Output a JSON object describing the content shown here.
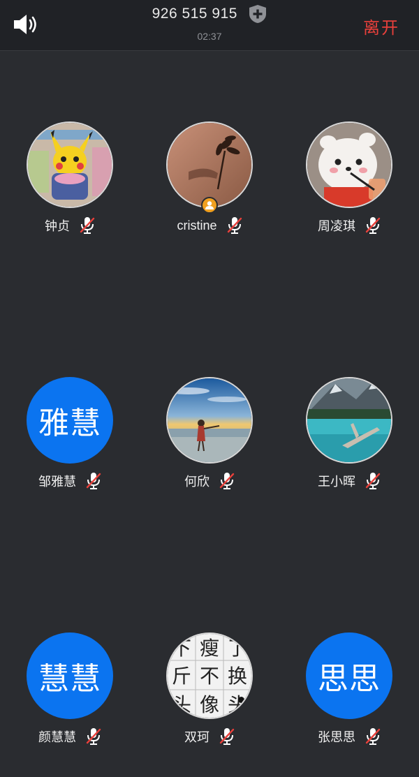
{
  "header": {
    "meeting_id": "926 515 915",
    "timer": "02:37",
    "leave_label": "离开",
    "speaker_icon": "speaker-icon",
    "shield_icon": "shield-plus-icon",
    "accent_color": "#e8403b"
  },
  "participants": [
    {
      "name": "钟贞",
      "avatar_type": "photo",
      "avatar_subject": "pikachu",
      "mic": "muted"
    },
    {
      "name": "cristine",
      "avatar_type": "photo",
      "avatar_subject": "flower-shadow",
      "mic": "muted",
      "host": true
    },
    {
      "name": "周凌琪",
      "avatar_type": "photo",
      "avatar_subject": "plush-toy",
      "mic": "muted"
    },
    {
      "name": "邹雅慧",
      "avatar_type": "text",
      "avatar_text": "雅慧",
      "mic": "muted"
    },
    {
      "name": "何欣",
      "avatar_type": "photo",
      "avatar_subject": "girl-at-sunset",
      "mic": "muted"
    },
    {
      "name": "王小晖",
      "avatar_type": "photo",
      "avatar_subject": "lake-landscape",
      "mic": "muted"
    },
    {
      "name": "颜慧慧",
      "avatar_type": "text",
      "avatar_text": "慧慧",
      "mic": "muted"
    },
    {
      "name": "双珂",
      "avatar_type": "photo",
      "avatar_subject": "character-grid",
      "mic": "muted",
      "grid_chars": [
        "下",
        "瘦",
        "了",
        "斤",
        "不",
        "换",
        "头",
        "像",
        "头"
      ]
    },
    {
      "name": "张思思",
      "avatar_type": "text",
      "avatar_text": "思思",
      "mic": "muted"
    }
  ],
  "colors": {
    "text_avatar_bg": "#0b74f0",
    "background": "#2a2c30",
    "mute_slash": "#e8403b"
  }
}
